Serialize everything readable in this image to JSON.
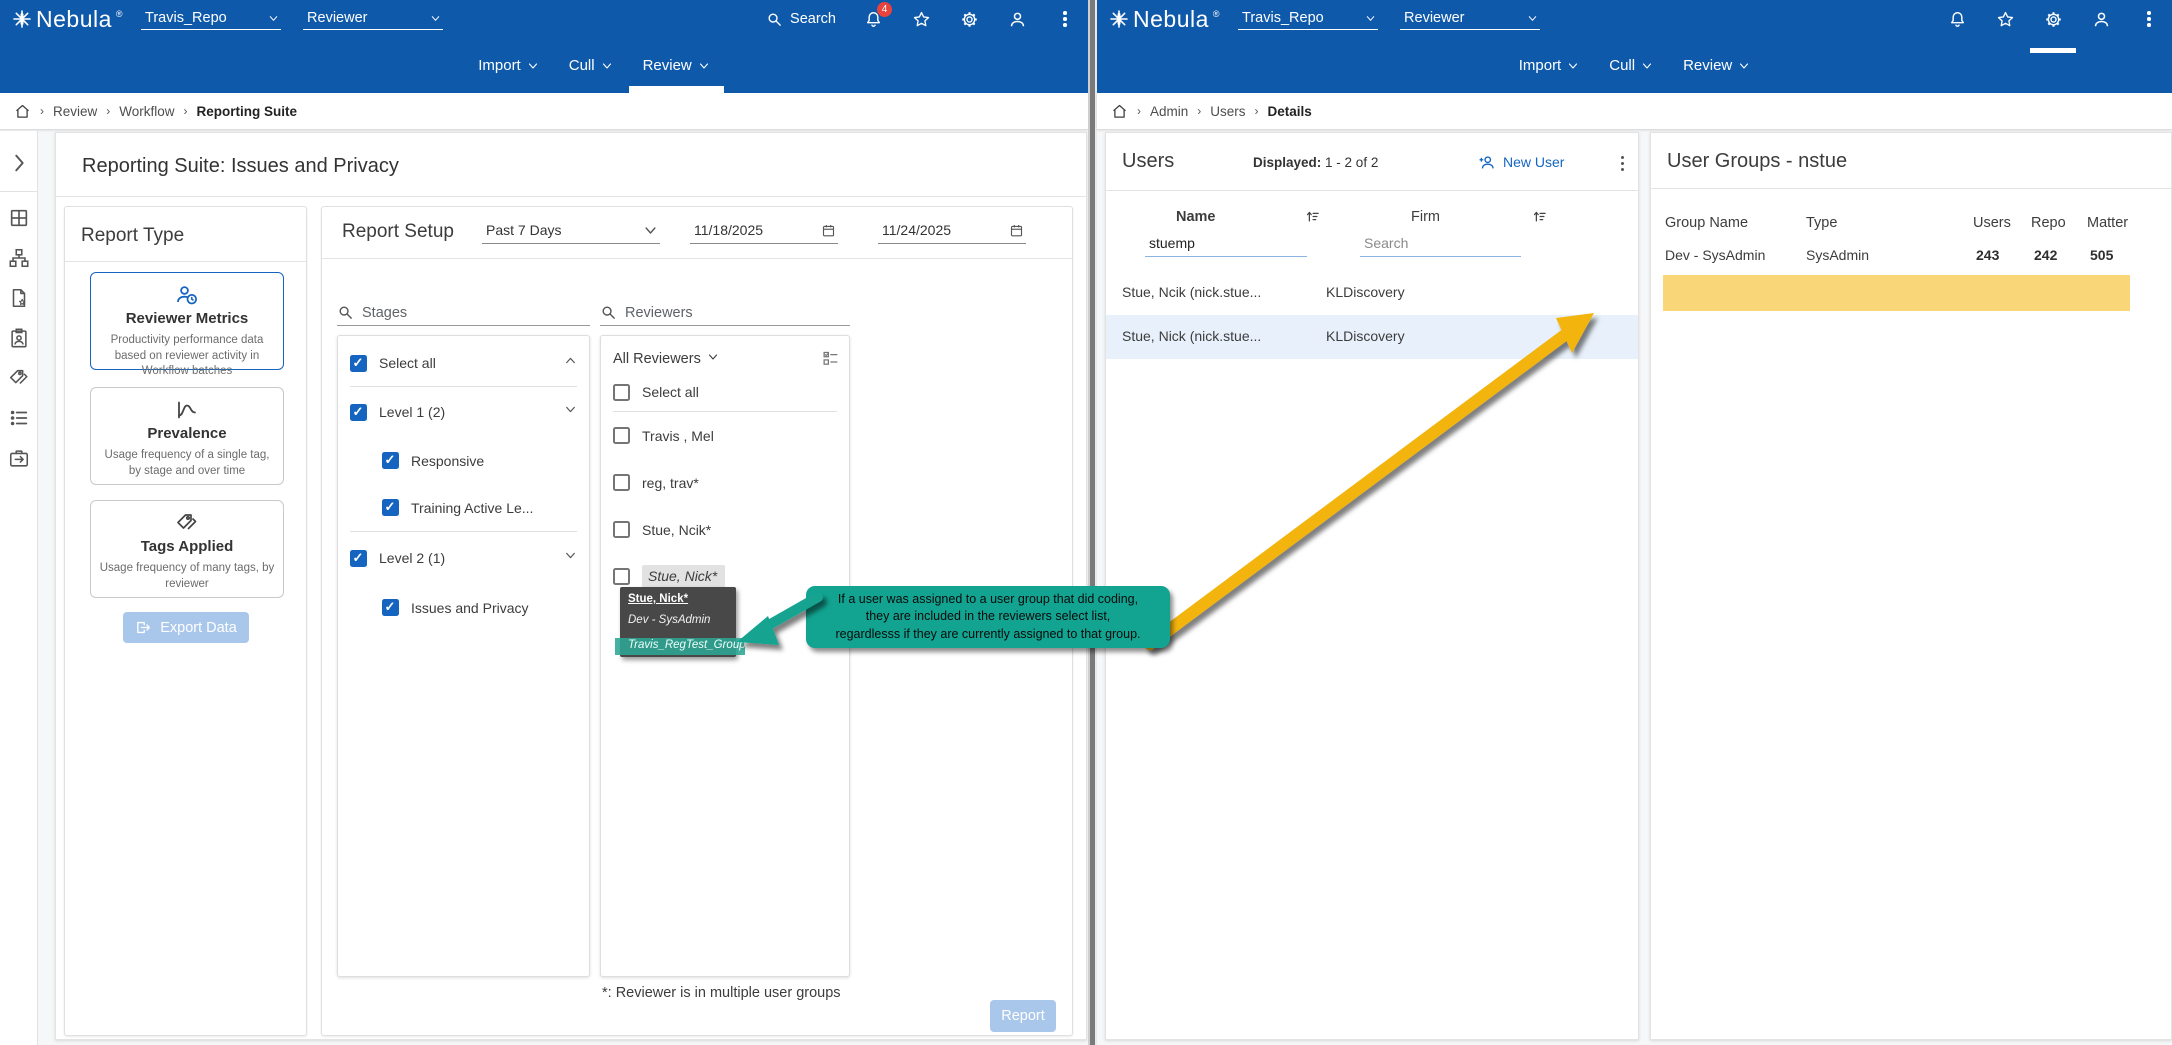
{
  "brand": {
    "logo_text": "Nebula",
    "repo": "Travis_Repo",
    "role": "Reviewer"
  },
  "nav": {
    "items": [
      "Import",
      "Cull",
      "Review"
    ]
  },
  "left_app": {
    "header": {
      "search_label": "Search",
      "notification_count": "4"
    },
    "breadcrumb": {
      "items": [
        "Review",
        "Workflow"
      ],
      "current": "Reporting Suite"
    },
    "page_title": "Reporting Suite: Issues and Privacy",
    "report_type": {
      "title": "Report Type",
      "cards": [
        {
          "name": "Reviewer Metrics",
          "desc": "Productivity performance data based on reviewer activity in Workflow batches"
        },
        {
          "name": "Prevalence",
          "desc": "Usage frequency of a single tag, by stage and over time"
        },
        {
          "name": "Tags Applied",
          "desc": "Usage frequency of many tags, by reviewer"
        }
      ],
      "export_button": "Export Data"
    },
    "report_setup": {
      "title": "Report Setup",
      "date_range": "Past 7 Days",
      "start_date": "11/18/2025",
      "end_date": "11/24/2025",
      "stages": {
        "search_placeholder": "Stages",
        "select_all": "Select all",
        "level1": "Level 1 (2)",
        "level1_children": [
          "Responsive",
          "Training Active Le..."
        ],
        "level2": "Level 2 (1)",
        "level2_children": [
          "Issues and Privacy"
        ]
      },
      "reviewers": {
        "search_placeholder": "Reviewers",
        "filter_label": "All Reviewers",
        "select_all": "Select all",
        "items": [
          "Travis , Mel",
          "reg, trav*",
          "Stue, Ncik*",
          "Stue, Nick*"
        ]
      },
      "footnote": "*: Reviewer is in multiple user groups",
      "report_button": "Report"
    },
    "tooltip": {
      "name": "Stue, Nick*",
      "group1": "Dev - SysAdmin",
      "group2": "Travis_RegTest_Group"
    },
    "callout": {
      "line1": "If a user was assigned to a user group that did coding,",
      "line2": "they are included in the reviewers select list,",
      "line3": "regardlesss if they are currently assigned to that group."
    }
  },
  "right_app": {
    "breadcrumb": {
      "items": [
        "Admin",
        "Users"
      ],
      "current": "Details"
    },
    "users_panel": {
      "title": "Users",
      "displayed_label": "Displayed:",
      "displayed_value": "1 - 2 of 2",
      "new_user_button": "New User",
      "col_name": "Name",
      "col_firm": "Firm",
      "name_filter_value": "stuemp",
      "firm_filter_placeholder": "Search",
      "rows": [
        {
          "name": "Stue, Ncik (nick.stue...",
          "firm": "KLDiscovery"
        },
        {
          "name": "Stue, Nick (nick.stue...",
          "firm": "KLDiscovery"
        }
      ]
    },
    "user_groups_panel": {
      "title": "User Groups - nstue",
      "col_group": "Group Name",
      "col_type": "Type",
      "col_users": "Users",
      "col_repo": "Repo",
      "col_matter": "Matter",
      "rows": [
        {
          "group_name": "Dev - SysAdmin",
          "type": "SysAdmin",
          "users": "243",
          "repo": "242",
          "matter": "505"
        }
      ]
    }
  },
  "colors": {
    "appbar_blue": "#0e59a9",
    "accent_blue": "#1565c0",
    "callout_teal": "#12a491",
    "arrow_yellow": "#f2b40a",
    "highlight_yellow": "#f9d678",
    "selected_row_blue": "#e8f1fb",
    "badge_red": "#e8433c",
    "tooltip_gray": "#484848"
  }
}
